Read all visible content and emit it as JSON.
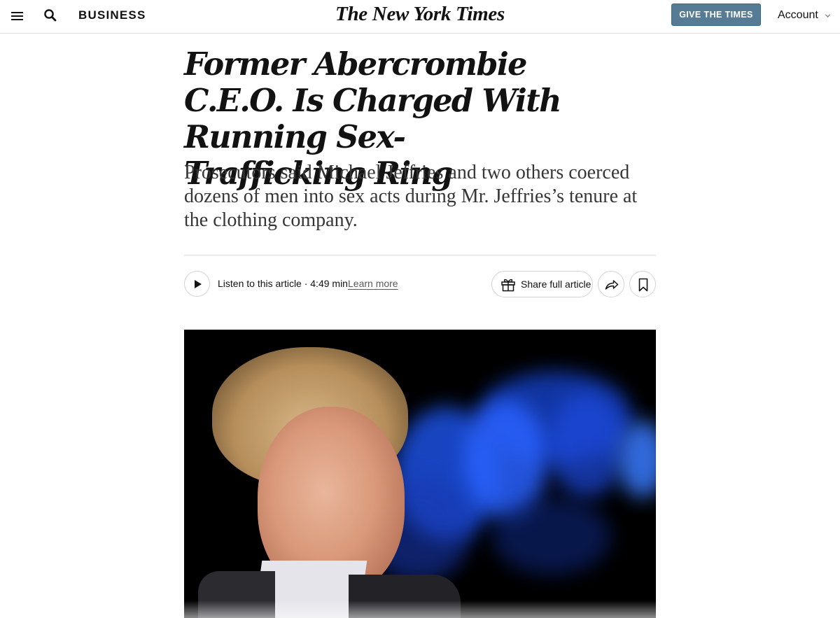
{
  "header": {
    "menu_icon": "hamburger-menu-icon",
    "search_icon": "search-icon",
    "section": "BUSINESS",
    "logo": "The New York Times",
    "give_button": "GIVE THE TIMES",
    "account": "Account",
    "account_icon": "chevron-down-icon",
    "give_button_color": "#567b95"
  },
  "article": {
    "headline": "Former Abercrombie C.E.O. Is Charged With Running Sex-Trafficking Ring",
    "summary": "Prosecutors said Michael Jeffries and two others coerced dozens of men into sex acts during Mr. Jeffries’s tenure at the clothing company.",
    "audio": {
      "play_icon": "play-icon",
      "listen_label": "Listen to this article · 4:49 min",
      "learn_more": "Learn more"
    },
    "tools": {
      "gift_icon": "gift-icon",
      "share_full_label": "Share full article",
      "share_icon": "share-arrow-icon",
      "bookmark_icon": "bookmark-icon"
    },
    "photo": {
      "icon": "lead-photo"
    }
  }
}
